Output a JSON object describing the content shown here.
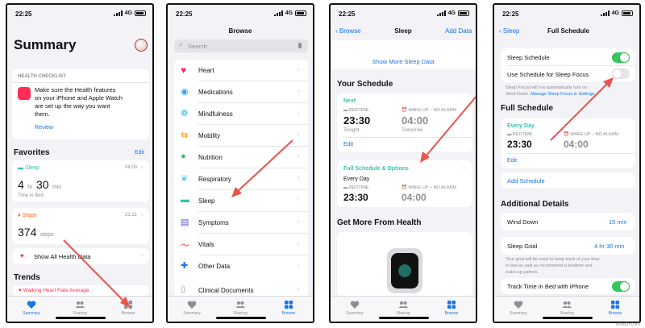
{
  "status": {
    "time": "22:25",
    "network": "4G"
  },
  "tabs": {
    "summary": "Summary",
    "sharing": "Sharing",
    "browse": "Browse"
  },
  "p1": {
    "title": "Summary",
    "checklist": {
      "heading": "HEALTH CHECKLIST",
      "text1": "Make sure the Health features",
      "text2": "on your iPhone and Apple Watch",
      "text3": "are set up the way you want",
      "text4": "them.",
      "link": "Review"
    },
    "favorites": "Favorites",
    "edit": "Edit",
    "sleep": {
      "label": "Sleep",
      "time": "04:00",
      "hr": "4",
      "hr_unit": "hr",
      "min": "30",
      "min_unit": "min",
      "caption": "Time in Bed"
    },
    "steps": {
      "label": "Steps",
      "time": "21:11",
      "value": "374",
      "unit": "steps"
    },
    "show_all": "Show All Health Data",
    "trends": "Trends",
    "trend_item": "Walking Heart Rate Average"
  },
  "p2": {
    "nav_title": "Browse",
    "search_placeholder": "Search",
    "items": [
      "Heart",
      "Medications",
      "Mindfulness",
      "Mobility",
      "Nutrition",
      "Respiratory",
      "Sleep",
      "Symptoms",
      "Vitals",
      "Other Data"
    ],
    "clinical": "Clinical Documents"
  },
  "p3": {
    "back": "Browse",
    "nav_title": "Sleep",
    "add": "Add Data",
    "show_more": "Show More Sleep Data",
    "your_schedule": "Your Schedule",
    "next": "Next",
    "bedtime": "BEDTIME",
    "wake": "WAKE UP – NO ALARM",
    "bed_time_val": "23:30",
    "wake_time_val": "04:00",
    "tonight": "Tonight",
    "tomorrow": "Tomorrow",
    "edit": "Edit",
    "full_options": "Full Schedule & Options",
    "every_day": "Every Day",
    "get_more": "Get More From Health"
  },
  "p4": {
    "back": "Sleep",
    "nav_title": "Full Schedule",
    "sleep_schedule": "Sleep Schedule",
    "use_schedule": "Use Schedule for Sleep Focus",
    "focus_note1": "Sleep Focus will not automatically turn on",
    "focus_note2": "Wind Down.",
    "focus_link": "Manage Sleep Focus in Settings",
    "full_schedule": "Full Schedule",
    "every_day": "Every Day",
    "bedtime": "BEDTIME",
    "wake": "WAKE UP – NO ALARM",
    "bed_val": "23:30",
    "wake_val": "04:00",
    "edit": "Edit",
    "add_schedule": "Add Schedule",
    "additional": "Additional Details",
    "wind_down": "Wind Down",
    "wind_down_val": "15 min",
    "sleep_goal": "Sleep Goal",
    "sleep_goal_val": "4 hr 30 min",
    "goal_note1": "Your goal will be used to keep track of your time",
    "goal_note2": "in bed as well as recommend a bedtime and",
    "goal_note3": "wake-up pattern.",
    "track": "Track Time in Bed with iPhone"
  },
  "watermark": "wsxdn.com",
  "colors": {
    "accent": "#1a73e8",
    "arrow": "#e8534a",
    "toggle_on": "#34c759",
    "heart": "#ff2d55",
    "sleep_teal": "#35c3a7",
    "steps_orange": "#ff6a28"
  }
}
